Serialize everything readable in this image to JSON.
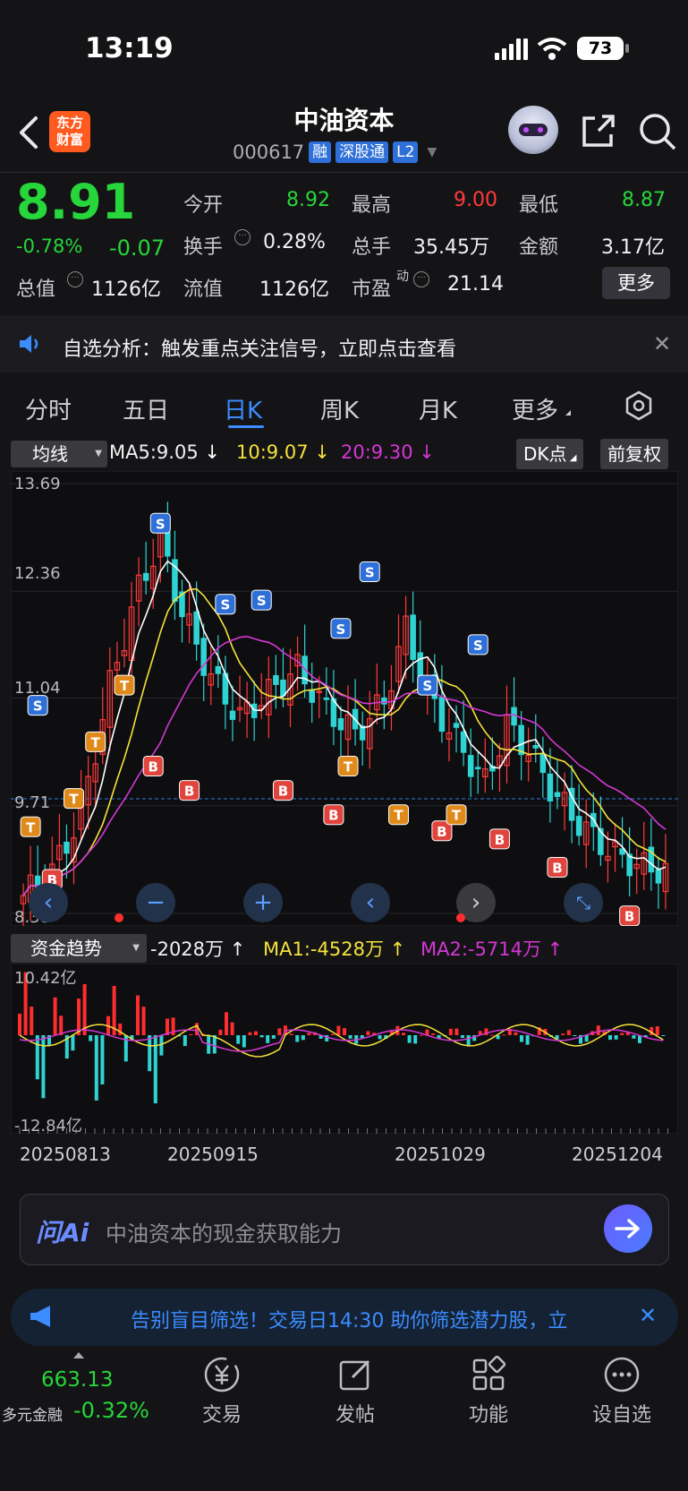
{
  "status_bar": {
    "time": "13:19",
    "battery": "73"
  },
  "header": {
    "title": "中油资本",
    "code": "000617",
    "tags": [
      "融",
      "深股通",
      "L2"
    ],
    "logo_line1": "东方",
    "logo_line2": "财富"
  },
  "quote": {
    "price": "8.91",
    "change_pct": "-0.78%",
    "change": "-0.07",
    "open_label": "今开",
    "open": "8.92",
    "high_label": "最高",
    "high": "9.00",
    "low_label": "最低",
    "low": "8.87",
    "turnover_label": "换手",
    "turnover": "0.28%",
    "volume_label": "总手",
    "volume": "35.45万",
    "amount_label": "金额",
    "amount": "3.17亿",
    "mktcap_label": "总值",
    "mktcap": "1126亿",
    "float_label": "流值",
    "float": "1126亿",
    "pe_label": "市盈",
    "pe_sup": "动",
    "pe": "21.14",
    "more_label": "更多"
  },
  "notice": {
    "text": "自选分析：触发重点关注信号，立即点击查看"
  },
  "tabs": [
    "分时",
    "五日",
    "日K",
    "周K",
    "月K",
    "更多"
  ],
  "active_tab": "日K",
  "kline": {
    "indicator_select": "均线",
    "ma5": "MA5:9.05",
    "ma10": "10:9.07",
    "ma20": "20:9.30",
    "dk_button": "DK点",
    "adjust_button": "前复权",
    "y_labels": [
      "13.69",
      "12.36",
      "11.04",
      "9.71",
      "8.38"
    ],
    "colors": {
      "up": "#ff3b3b",
      "down": "#2fd3d3",
      "ma5": "#ffffff",
      "ma10": "#f5e23a",
      "ma20": "#d437d4"
    }
  },
  "fund_flow": {
    "select": "资金趋势",
    "value": "-2028万",
    "ma1": "MA1:-4528万",
    "ma2": "MA2:-5714万",
    "y_top": "10.42亿",
    "y_bottom": "-12.84亿"
  },
  "dates": [
    "20250813",
    "20250915",
    "20251029",
    "20251204"
  ],
  "ai_box": {
    "logo": "问Ai",
    "placeholder": "中油资本的现金获取能力"
  },
  "banner": {
    "text": "告别盲目筛选！交易日14:30 助你筛选潜力股，立"
  },
  "bottom_nav": {
    "index_value": "663.13",
    "index_name": "多元金融",
    "index_change": "-0.32%",
    "items": [
      "交易",
      "发帖",
      "功能",
      "设自选"
    ]
  }
}
